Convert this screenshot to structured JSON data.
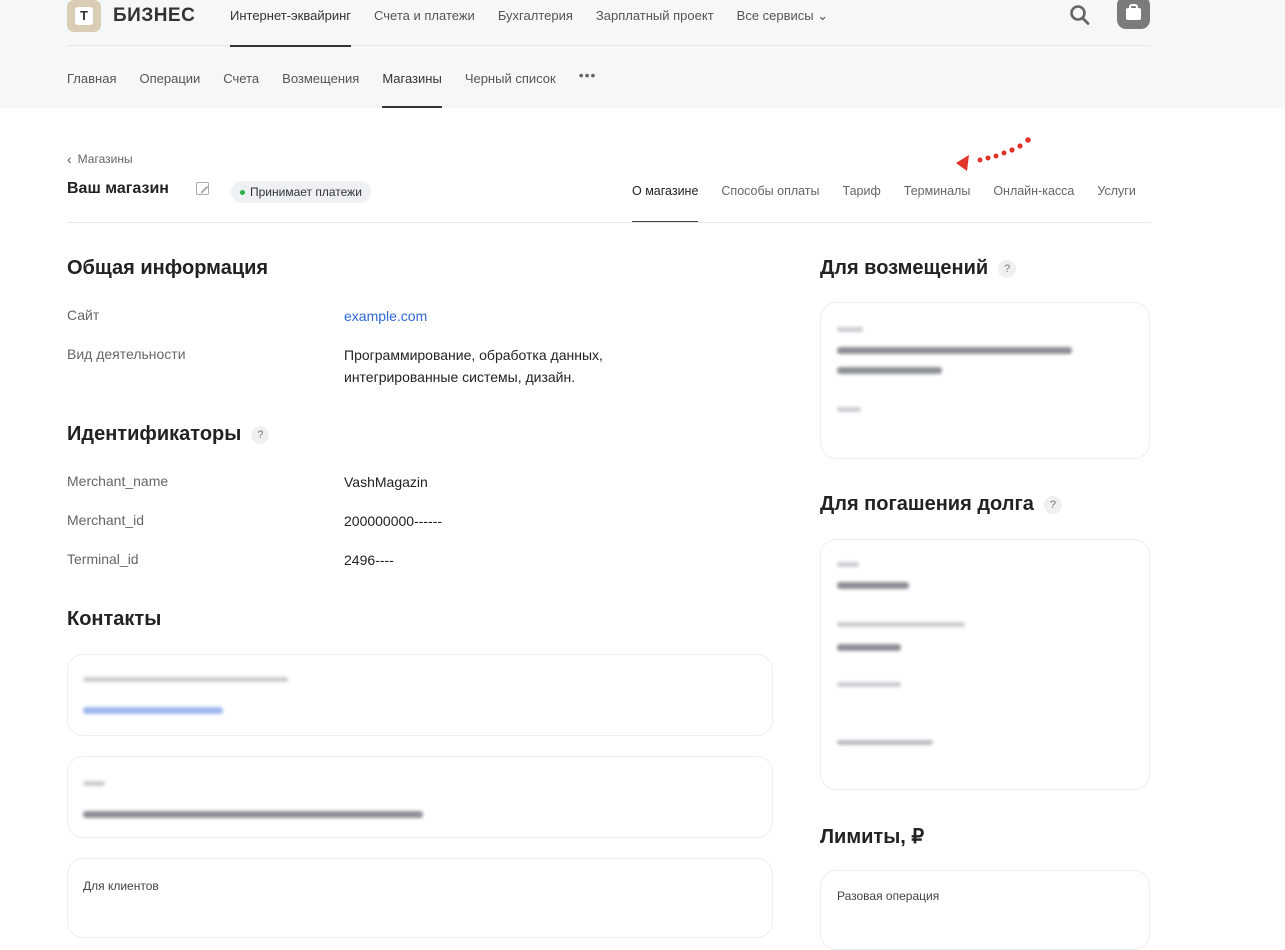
{
  "header": {
    "logo_letter": "Т",
    "logo_text": "БИЗНЕС",
    "nav": [
      {
        "label": "Интернет-эквайринг",
        "active": true
      },
      {
        "label": "Счета и платежи"
      },
      {
        "label": "Бухгалтерия"
      },
      {
        "label": "Зарплатный проект"
      },
      {
        "label": "Все сервисы ⌄"
      }
    ],
    "search_icon": "search-icon",
    "profile_icon": "briefcase-icon"
  },
  "subnav": {
    "items": [
      {
        "label": "Главная"
      },
      {
        "label": "Операции"
      },
      {
        "label": "Счета"
      },
      {
        "label": "Возмещения"
      },
      {
        "label": "Магазины",
        "active": true
      },
      {
        "label": "Черный список"
      }
    ],
    "more": "•••"
  },
  "shop": {
    "back_label": "Магазины",
    "title": "Ваш магазин",
    "status": "Принимает платежи",
    "status_color": "#27b24a",
    "tabs": [
      {
        "label": "О магазине",
        "active": true
      },
      {
        "label": "Способы оплаты"
      },
      {
        "label": "Тариф"
      },
      {
        "label": "Терминалы"
      },
      {
        "label": "Онлайн-касса"
      },
      {
        "label": "Услуги"
      }
    ]
  },
  "general": {
    "title": "Общая информация",
    "site_label": "Сайт",
    "site_value": "example.com",
    "activity_label": "Вид деятельности",
    "activity_line1": "Программирование, обработка данных,",
    "activity_line2": "интегрированные системы, дизайн."
  },
  "identifiers": {
    "title": "Идентификаторы",
    "help": "?",
    "rows": [
      {
        "label": "Merchant_name",
        "value": "VashMagazin"
      },
      {
        "label": "Merchant_id",
        "value": "200000000------"
      },
      {
        "label": "Terminal_id",
        "value": "2496----"
      }
    ]
  },
  "contacts": {
    "title": "Контакты",
    "for_clients_label": "Для клиентов"
  },
  "reimbursement": {
    "title": "Для возмещений",
    "help": "?"
  },
  "debt": {
    "title": "Для погашения долга",
    "help": "?"
  },
  "limits": {
    "title": "Лимиты, ₽",
    "single_op_label": "Разовая операция"
  },
  "colors": {
    "link": "#3168d6",
    "annotation": "#e0342b"
  }
}
